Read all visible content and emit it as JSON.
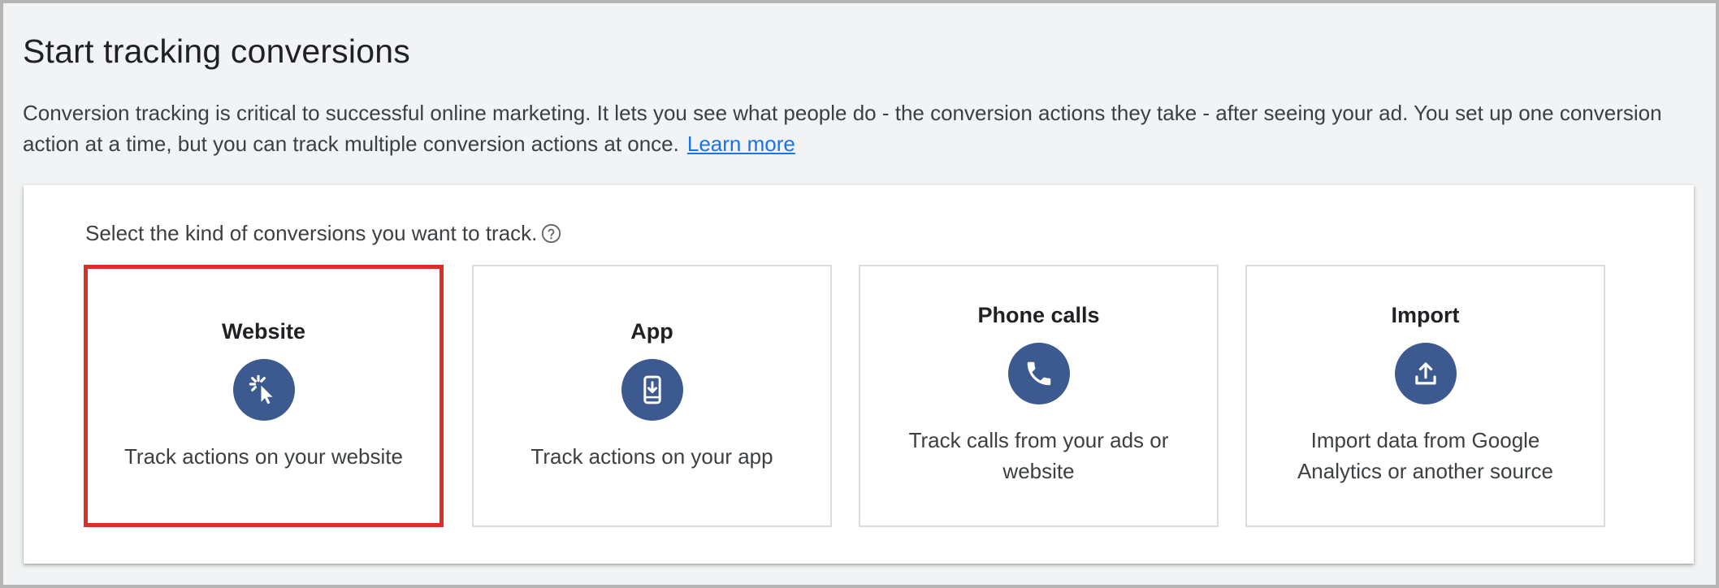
{
  "header": {
    "title": "Start tracking conversions",
    "intro": "Conversion tracking is critical to successful online marketing. It lets you see what people do - the conversion actions they take - after seeing your ad. You set up one conversion action at a time, but you can track multiple conversion actions at once.",
    "learn_more": "Learn more"
  },
  "selector": {
    "prompt": "Select the kind of conversions you want to track.",
    "selected": "website",
    "cards": [
      {
        "id": "website",
        "title": "Website",
        "description": "Track actions on your website",
        "icon": "cursor-click-icon"
      },
      {
        "id": "app",
        "title": "App",
        "description": "Track actions on your app",
        "icon": "phone-download-icon"
      },
      {
        "id": "phone-calls",
        "title": "Phone calls",
        "description": "Track calls from your ads or website",
        "icon": "phone-handset-icon"
      },
      {
        "id": "import",
        "title": "Import",
        "description": "Import data from Google Analytics or another source",
        "icon": "upload-icon"
      }
    ]
  },
  "colors": {
    "icon_bg": "#3c5a8f",
    "selected_border": "#d93025",
    "link": "#1a73e8"
  }
}
